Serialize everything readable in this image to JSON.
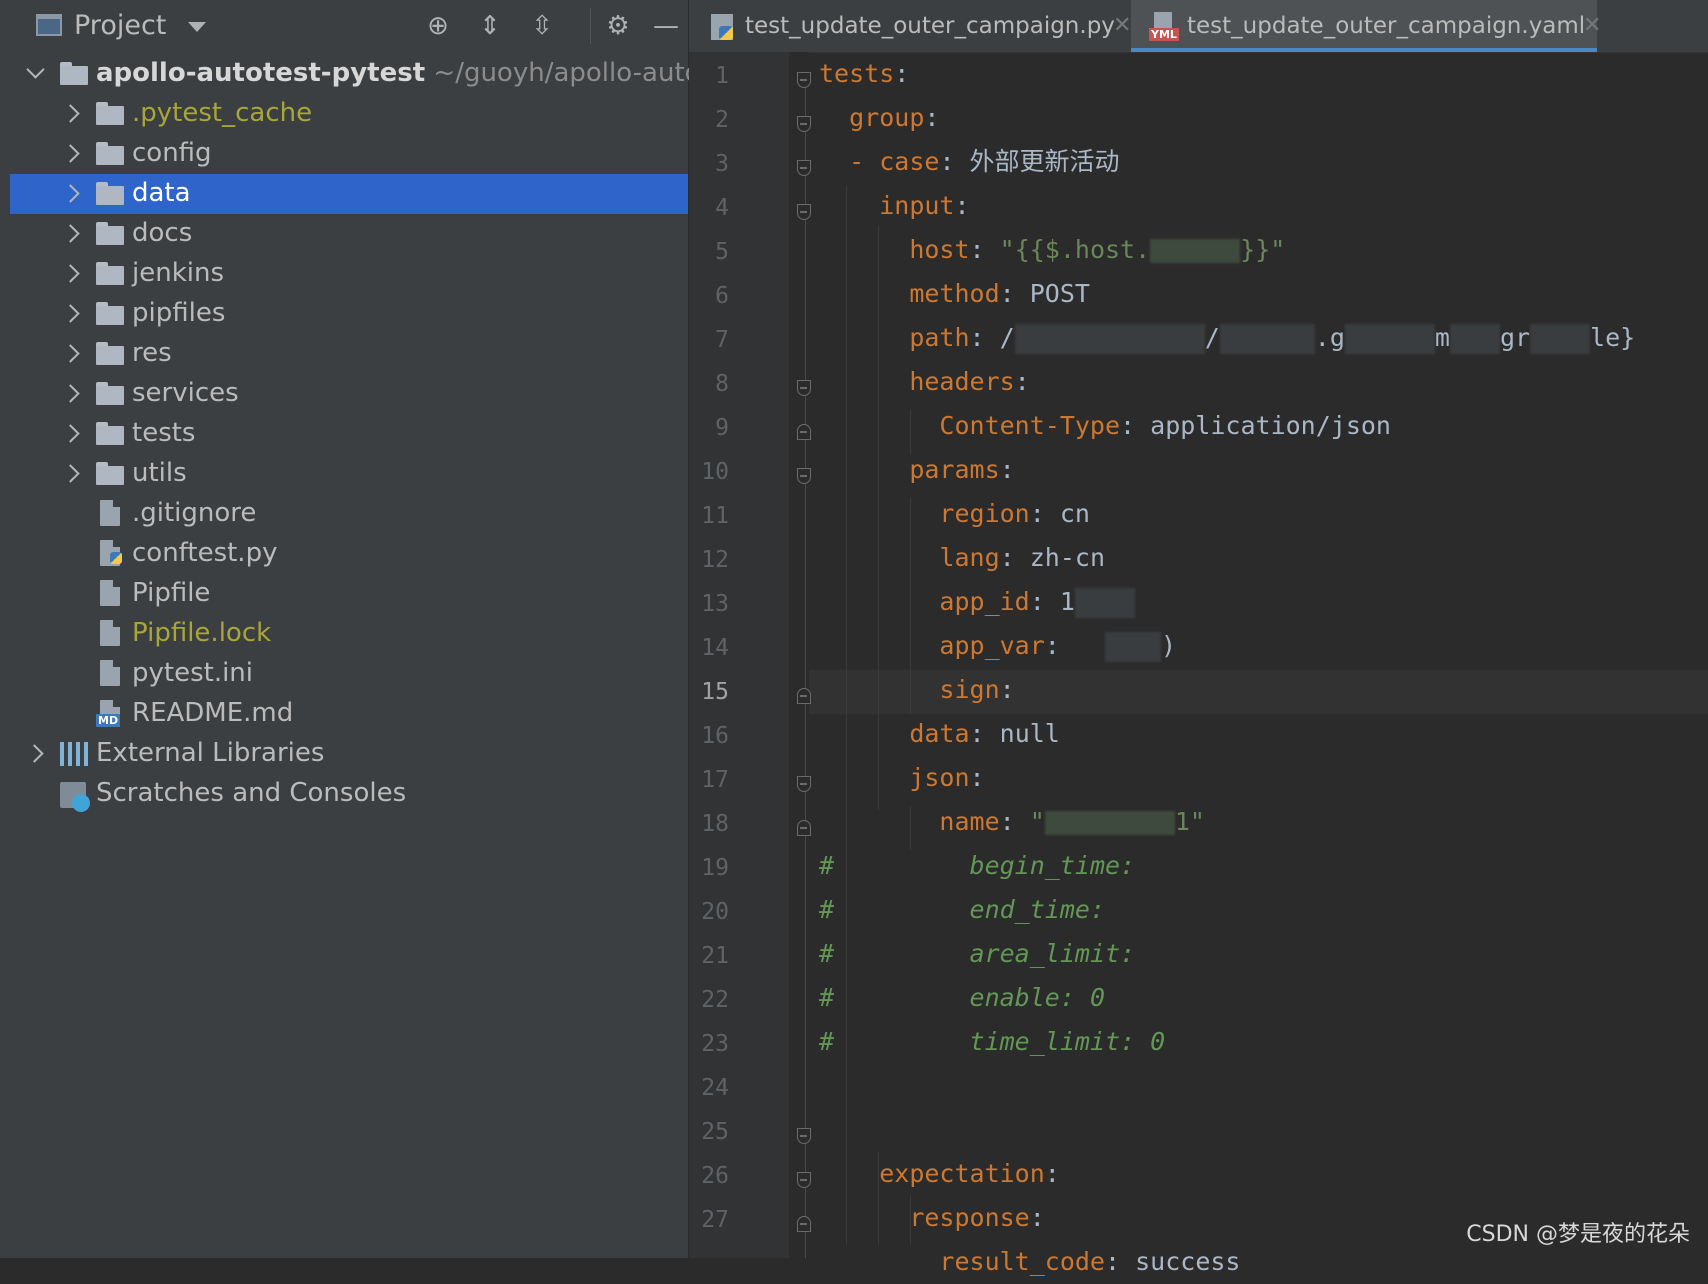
{
  "project_panel": {
    "title": "Project",
    "root": {
      "name": "apollo-autotest-pytest",
      "path": "~/guoyh/apollo-autot"
    },
    "items": [
      {
        "label": ".pytest_cache",
        "kind": "folder"
      },
      {
        "label": "config",
        "kind": "folder"
      },
      {
        "label": "data",
        "kind": "folder",
        "selected": true
      },
      {
        "label": "docs",
        "kind": "folder"
      },
      {
        "label": "jenkins",
        "kind": "folder"
      },
      {
        "label": "pipfiles",
        "kind": "folder"
      },
      {
        "label": "res",
        "kind": "folder"
      },
      {
        "label": "services",
        "kind": "folder"
      },
      {
        "label": "tests",
        "kind": "folder"
      },
      {
        "label": "utils",
        "kind": "folder"
      },
      {
        "label": ".gitignore",
        "kind": "file"
      },
      {
        "label": "conftest.py",
        "kind": "file"
      },
      {
        "label": "Pipfile",
        "kind": "file"
      },
      {
        "label": "Pipfile.lock",
        "kind": "file"
      },
      {
        "label": "pytest.ini",
        "kind": "file"
      },
      {
        "label": "README.md",
        "kind": "file"
      }
    ],
    "external_libraries": "External Libraries",
    "scratches": "Scratches and Consoles"
  },
  "tabs": [
    {
      "label": "test_update_outer_campaign.py",
      "icon": "python-file-icon",
      "active": false
    },
    {
      "label": "test_update_outer_campaign.yaml",
      "icon": "yaml-file-icon",
      "active": true
    }
  ],
  "editor": {
    "current_line": 15,
    "line_numbers": [
      "1",
      "2",
      "3",
      "4",
      "5",
      "6",
      "7",
      "8",
      "9",
      "10",
      "11",
      "12",
      "13",
      "14",
      "15",
      "16",
      "17",
      "18",
      "19",
      "20",
      "21",
      "22",
      "23",
      "24",
      "25",
      "26",
      "27"
    ],
    "code": {
      "l1": "tests",
      "l2": "group",
      "l3_key": "case",
      "l3_val": "外部更新活动",
      "l4": "input",
      "l5_key": "host",
      "l5_val_a": "\"{{$.host.",
      "l5_val_b": "}}\"",
      "l6_key": "method",
      "l6_val": "POST",
      "l7_key": "path",
      "l7_val_a": "/",
      "l7_val_b": "/",
      "l7_val_c": ".g",
      "l7_val_d": "m",
      "l7_val_e": "gr",
      "l7_val_f": "le}",
      "l8": "headers",
      "l9_key": "Content-Type",
      "l9_val": "application/json",
      "l10": "params",
      "l11_key": "region",
      "l11_val": "cn",
      "l12_key": "lang",
      "l12_val": "zh-cn",
      "l13_key": "app_id",
      "l13_val": "1",
      "l14_key": "app_var",
      "l14_val": ")",
      "l15": "sign",
      "l16_key": "data",
      "l16_val": "null",
      "l17": "json",
      "l18_key": "name",
      "l18_val_a": "\"",
      "l18_val_b": "1\"",
      "l19": "begin_time:",
      "l20": "end_time:",
      "l21": "area_limit:",
      "l22": "enable: 0",
      "l23": "time_limit: 0",
      "l25": "expectation",
      "l26": "response",
      "l27_key": "result_code",
      "l27_val": "success"
    }
  },
  "watermark": "CSDN @梦是夜的花朵"
}
